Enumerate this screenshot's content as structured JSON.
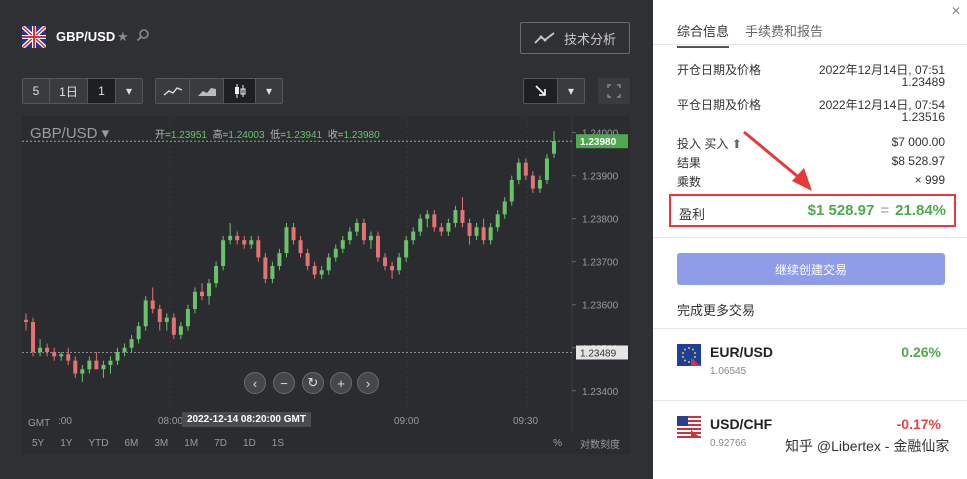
{
  "header": {
    "pair": "GBP/USD",
    "tech_analysis": "技术分析"
  },
  "toolbar": {
    "count": "5",
    "period": "1日",
    "interval": "1",
    "chevron": "▾"
  },
  "chart": {
    "instrument": "GBP/USD",
    "open_label": "开=",
    "open": "1.23951",
    "high_label": "高=",
    "high": "1.24003",
    "low_label": "低=",
    "low": "1.23941",
    "close_label": "收=",
    "close": "1.23980",
    "y_ticks": [
      "1.24000",
      "1.23900",
      "1.23800",
      "1.23700",
      "1.23600",
      "1.23500",
      "1.23400"
    ],
    "current_price": "1.23980",
    "entry_price": "1.23489",
    "x_ticks": [
      ":00",
      "08:00",
      "09:00",
      "09:30"
    ],
    "timezone": "GMT",
    "crosshair_time": "2022-12-14 08:20:00 GMT",
    "periods": [
      "5Y",
      "1Y",
      "YTD",
      "6M",
      "3M",
      "1M",
      "7D",
      "1D",
      "1S"
    ],
    "percent": "%",
    "log_scale": "对数刻度",
    "colors": {
      "up": "#69c36b",
      "down": "#e57373"
    }
  },
  "details": {
    "tabs": [
      "综合信息",
      "手续费和报告"
    ],
    "open_label": "开仓日期及价格",
    "open_date": "2022年12月14日, 07:51",
    "open_price": "1.23489",
    "close_label": "平仓日期及价格",
    "close_date": "2022年12月14日, 07:54",
    "close_price": "1.23516",
    "invest_label": "投入 买入",
    "invest_value": "$7 000.00",
    "result_label": "结果",
    "result_value": "$8 528.97",
    "multiplier_label": "乘数",
    "multiplier_value": "× 999",
    "profit_label": "盈利",
    "profit_value": "$1 528.97",
    "profit_eq": "=",
    "profit_pct": "21.84%",
    "cta": "继续创建交易",
    "more_title": "完成更多交易"
  },
  "assets": [
    {
      "symbol": "EUR/USD",
      "price": "1.06545",
      "change": "0.26%",
      "color": "#4fa84f"
    },
    {
      "symbol": "USD/CHF",
      "price": "0.92766",
      "change": "-0.17%",
      "color": "#e04848"
    }
  ],
  "watermark": "知乎 @Libertex - 金融仙家",
  "chart_data": {
    "type": "candlestick",
    "ylim": [
      1.2336,
      1.2402
    ],
    "candles": [
      [
        1.23565,
        1.2358,
        1.2354,
        1.2356
      ],
      [
        1.2356,
        1.2357,
        1.2348,
        1.2349
      ],
      [
        1.2349,
        1.2352,
        1.2348,
        1.235
      ],
      [
        1.235,
        1.2351,
        1.2348,
        1.2349
      ],
      [
        1.2349,
        1.235,
        1.2347,
        1.2348
      ],
      [
        1.2348,
        1.2349,
        1.2347,
        1.23485
      ],
      [
        1.23485,
        1.235,
        1.2346,
        1.2347
      ],
      [
        1.2347,
        1.2348,
        1.2343,
        1.2344
      ],
      [
        1.2344,
        1.2346,
        1.2342,
        1.2345
      ],
      [
        1.2345,
        1.2348,
        1.2344,
        1.2347
      ],
      [
        1.2347,
        1.2349,
        1.2346,
        1.2345
      ],
      [
        1.2345,
        1.2347,
        1.2343,
        1.2346
      ],
      [
        1.2346,
        1.2348,
        1.2344,
        1.2347
      ],
      [
        1.2347,
        1.235,
        1.2346,
        1.2349
      ],
      [
        1.2349,
        1.2351,
        1.2348,
        1.235
      ],
      [
        1.235,
        1.2353,
        1.2349,
        1.2352
      ],
      [
        1.2352,
        1.2356,
        1.2351,
        1.2355
      ],
      [
        1.2355,
        1.2362,
        1.2354,
        1.2361
      ],
      [
        1.2361,
        1.2364,
        1.2358,
        1.2359
      ],
      [
        1.2359,
        1.236,
        1.2354,
        1.2356
      ],
      [
        1.2356,
        1.2358,
        1.2354,
        1.2357
      ],
      [
        1.2357,
        1.2358,
        1.2352,
        1.2353
      ],
      [
        1.2353,
        1.2356,
        1.2352,
        1.2355
      ],
      [
        1.2355,
        1.236,
        1.2354,
        1.2359
      ],
      [
        1.2359,
        1.2364,
        1.2358,
        1.2363
      ],
      [
        1.2363,
        1.2365,
        1.2361,
        1.2362
      ],
      [
        1.2362,
        1.2366,
        1.236,
        1.2365
      ],
      [
        1.2365,
        1.237,
        1.2364,
        1.2369
      ],
      [
        1.2369,
        1.2376,
        1.2368,
        1.2375
      ],
      [
        1.2375,
        1.2379,
        1.2374,
        1.2376
      ],
      [
        1.2376,
        1.2377,
        1.2374,
        1.2375
      ],
      [
        1.2375,
        1.2376,
        1.2373,
        1.2374
      ],
      [
        1.2374,
        1.2376,
        1.2373,
        1.2375
      ],
      [
        1.2375,
        1.2376,
        1.237,
        1.2371
      ],
      [
        1.2371,
        1.2372,
        1.2365,
        1.2366
      ],
      [
        1.2366,
        1.237,
        1.2365,
        1.2369
      ],
      [
        1.2369,
        1.2373,
        1.2368,
        1.2372
      ],
      [
        1.2372,
        1.2379,
        1.2371,
        1.2378
      ],
      [
        1.2378,
        1.2379,
        1.2374,
        1.2375
      ],
      [
        1.2375,
        1.2376,
        1.2371,
        1.2372
      ],
      [
        1.2372,
        1.2373,
        1.2368,
        1.2369
      ],
      [
        1.2369,
        1.237,
        1.2366,
        1.2367
      ],
      [
        1.2367,
        1.2369,
        1.2366,
        1.2368
      ],
      [
        1.2368,
        1.2372,
        1.2367,
        1.2371
      ],
      [
        1.2371,
        1.2374,
        1.237,
        1.2373
      ],
      [
        1.2373,
        1.2376,
        1.2372,
        1.2375
      ],
      [
        1.2375,
        1.2378,
        1.2374,
        1.2377
      ],
      [
        1.2377,
        1.238,
        1.2376,
        1.2379
      ],
      [
        1.2379,
        1.238,
        1.2374,
        1.2375
      ],
      [
        1.2375,
        1.2377,
        1.2373,
        1.2376
      ],
      [
        1.2376,
        1.2377,
        1.237,
        1.2371
      ],
      [
        1.2371,
        1.2372,
        1.2368,
        1.2369
      ],
      [
        1.2369,
        1.237,
        1.2366,
        1.2368
      ],
      [
        1.2368,
        1.2372,
        1.2367,
        1.2371
      ],
      [
        1.2371,
        1.2376,
        1.237,
        1.2375
      ],
      [
        1.2375,
        1.2378,
        1.2374,
        1.2377
      ],
      [
        1.2377,
        1.2381,
        1.2376,
        1.238
      ],
      [
        1.238,
        1.2382,
        1.2378,
        1.2381
      ],
      [
        1.2381,
        1.2382,
        1.2377,
        1.2378
      ],
      [
        1.2378,
        1.2379,
        1.2376,
        1.2377
      ],
      [
        1.2377,
        1.238,
        1.2376,
        1.2379
      ],
      [
        1.2379,
        1.2383,
        1.2378,
        1.2382
      ],
      [
        1.2382,
        1.2385,
        1.2378,
        1.2379
      ],
      [
        1.2379,
        1.238,
        1.2374,
        1.2376
      ],
      [
        1.2376,
        1.2379,
        1.2375,
        1.2378
      ],
      [
        1.2378,
        1.238,
        1.2374,
        1.2375
      ],
      [
        1.2375,
        1.2379,
        1.2374,
        1.2378
      ],
      [
        1.2378,
        1.2382,
        1.2377,
        1.2381
      ],
      [
        1.2381,
        1.2385,
        1.238,
        1.2384
      ],
      [
        1.2384,
        1.239,
        1.2383,
        1.2389
      ],
      [
        1.2389,
        1.2394,
        1.2388,
        1.2393
      ],
      [
        1.2393,
        1.2394,
        1.2389,
        1.239
      ],
      [
        1.239,
        1.2391,
        1.2386,
        1.2387
      ],
      [
        1.2387,
        1.239,
        1.2386,
        1.2389
      ],
      [
        1.2389,
        1.2395,
        1.2388,
        1.2394
      ],
      [
        1.23951,
        1.24003,
        1.23941,
        1.2398
      ]
    ]
  }
}
